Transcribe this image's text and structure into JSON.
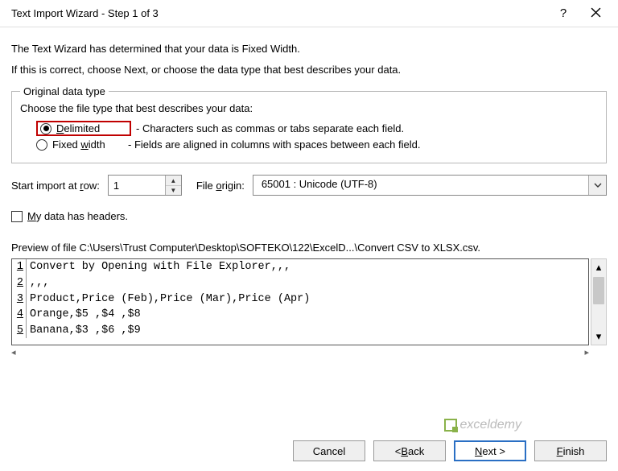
{
  "window": {
    "title": "Text Import Wizard - Step 1 of 3"
  },
  "desc": {
    "line1": "The Text Wizard has determined that your data is Fixed Width.",
    "line2": "If this is correct, choose Next, or choose the data type that best describes your data."
  },
  "group": {
    "legend": "Original data type",
    "prompt": "Choose the file type that best describes your data:",
    "options": {
      "delimited": {
        "label": "Delimited",
        "desc": "- Characters such as commas or tabs separate each field."
      },
      "fixed": {
        "label": "Fixed width",
        "desc": "- Fields are aligned in columns with spaces between each field."
      }
    }
  },
  "import_row": {
    "label": "Start import at row:",
    "value": "1",
    "origin_label": "File origin:",
    "origin_value": "65001 : Unicode (UTF-8)"
  },
  "headers": {
    "label": "My data has headers."
  },
  "preview": {
    "label": "Preview of file C:\\Users\\Trust Computer\\Desktop\\SOFTEKO\\122\\ExcelD...\\Convert CSV to XLSX.csv.",
    "lines": [
      "Convert by Opening with File Explorer,,,",
      ",,,",
      "Product,Price (Feb),Price (Mar),Price (Apr)",
      "Orange,$5 ,$4 ,$8",
      "Banana,$3 ,$6 ,$9"
    ]
  },
  "buttons": {
    "cancel": "Cancel",
    "back": "< Back",
    "next": "Next >",
    "finish": "Finish"
  },
  "watermark": "exceldemy"
}
